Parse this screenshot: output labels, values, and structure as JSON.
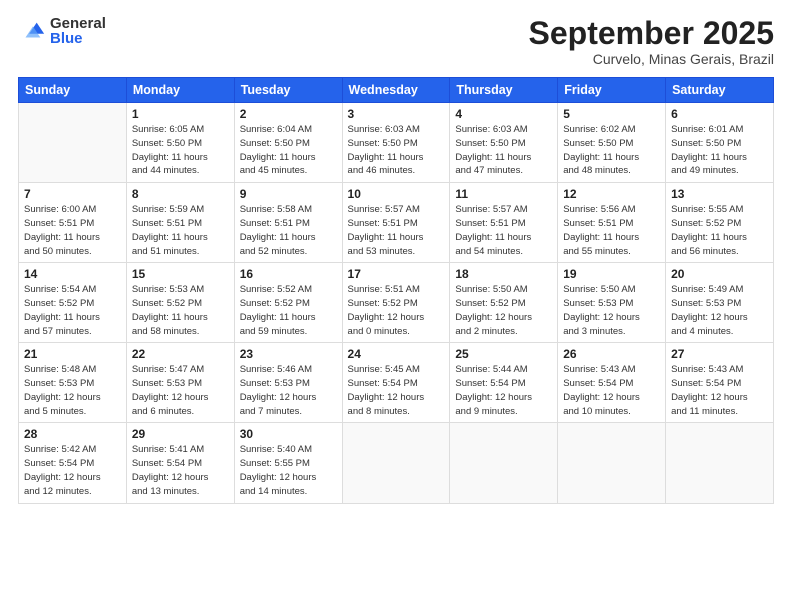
{
  "logo": {
    "general": "General",
    "blue": "Blue"
  },
  "title": "September 2025",
  "location": "Curvelo, Minas Gerais, Brazil",
  "days_of_week": [
    "Sunday",
    "Monday",
    "Tuesday",
    "Wednesday",
    "Thursday",
    "Friday",
    "Saturday"
  ],
  "weeks": [
    [
      {
        "day": "",
        "info": ""
      },
      {
        "day": "1",
        "info": "Sunrise: 6:05 AM\nSunset: 5:50 PM\nDaylight: 11 hours\nand 44 minutes."
      },
      {
        "day": "2",
        "info": "Sunrise: 6:04 AM\nSunset: 5:50 PM\nDaylight: 11 hours\nand 45 minutes."
      },
      {
        "day": "3",
        "info": "Sunrise: 6:03 AM\nSunset: 5:50 PM\nDaylight: 11 hours\nand 46 minutes."
      },
      {
        "day": "4",
        "info": "Sunrise: 6:03 AM\nSunset: 5:50 PM\nDaylight: 11 hours\nand 47 minutes."
      },
      {
        "day": "5",
        "info": "Sunrise: 6:02 AM\nSunset: 5:50 PM\nDaylight: 11 hours\nand 48 minutes."
      },
      {
        "day": "6",
        "info": "Sunrise: 6:01 AM\nSunset: 5:50 PM\nDaylight: 11 hours\nand 49 minutes."
      }
    ],
    [
      {
        "day": "7",
        "info": "Sunrise: 6:00 AM\nSunset: 5:51 PM\nDaylight: 11 hours\nand 50 minutes."
      },
      {
        "day": "8",
        "info": "Sunrise: 5:59 AM\nSunset: 5:51 PM\nDaylight: 11 hours\nand 51 minutes."
      },
      {
        "day": "9",
        "info": "Sunrise: 5:58 AM\nSunset: 5:51 PM\nDaylight: 11 hours\nand 52 minutes."
      },
      {
        "day": "10",
        "info": "Sunrise: 5:57 AM\nSunset: 5:51 PM\nDaylight: 11 hours\nand 53 minutes."
      },
      {
        "day": "11",
        "info": "Sunrise: 5:57 AM\nSunset: 5:51 PM\nDaylight: 11 hours\nand 54 minutes."
      },
      {
        "day": "12",
        "info": "Sunrise: 5:56 AM\nSunset: 5:51 PM\nDaylight: 11 hours\nand 55 minutes."
      },
      {
        "day": "13",
        "info": "Sunrise: 5:55 AM\nSunset: 5:52 PM\nDaylight: 11 hours\nand 56 minutes."
      }
    ],
    [
      {
        "day": "14",
        "info": "Sunrise: 5:54 AM\nSunset: 5:52 PM\nDaylight: 11 hours\nand 57 minutes."
      },
      {
        "day": "15",
        "info": "Sunrise: 5:53 AM\nSunset: 5:52 PM\nDaylight: 11 hours\nand 58 minutes."
      },
      {
        "day": "16",
        "info": "Sunrise: 5:52 AM\nSunset: 5:52 PM\nDaylight: 11 hours\nand 59 minutes."
      },
      {
        "day": "17",
        "info": "Sunrise: 5:51 AM\nSunset: 5:52 PM\nDaylight: 12 hours\nand 0 minutes."
      },
      {
        "day": "18",
        "info": "Sunrise: 5:50 AM\nSunset: 5:52 PM\nDaylight: 12 hours\nand 2 minutes."
      },
      {
        "day": "19",
        "info": "Sunrise: 5:50 AM\nSunset: 5:53 PM\nDaylight: 12 hours\nand 3 minutes."
      },
      {
        "day": "20",
        "info": "Sunrise: 5:49 AM\nSunset: 5:53 PM\nDaylight: 12 hours\nand 4 minutes."
      }
    ],
    [
      {
        "day": "21",
        "info": "Sunrise: 5:48 AM\nSunset: 5:53 PM\nDaylight: 12 hours\nand 5 minutes."
      },
      {
        "day": "22",
        "info": "Sunrise: 5:47 AM\nSunset: 5:53 PM\nDaylight: 12 hours\nand 6 minutes."
      },
      {
        "day": "23",
        "info": "Sunrise: 5:46 AM\nSunset: 5:53 PM\nDaylight: 12 hours\nand 7 minutes."
      },
      {
        "day": "24",
        "info": "Sunrise: 5:45 AM\nSunset: 5:54 PM\nDaylight: 12 hours\nand 8 minutes."
      },
      {
        "day": "25",
        "info": "Sunrise: 5:44 AM\nSunset: 5:54 PM\nDaylight: 12 hours\nand 9 minutes."
      },
      {
        "day": "26",
        "info": "Sunrise: 5:43 AM\nSunset: 5:54 PM\nDaylight: 12 hours\nand 10 minutes."
      },
      {
        "day": "27",
        "info": "Sunrise: 5:43 AM\nSunset: 5:54 PM\nDaylight: 12 hours\nand 11 minutes."
      }
    ],
    [
      {
        "day": "28",
        "info": "Sunrise: 5:42 AM\nSunset: 5:54 PM\nDaylight: 12 hours\nand 12 minutes."
      },
      {
        "day": "29",
        "info": "Sunrise: 5:41 AM\nSunset: 5:54 PM\nDaylight: 12 hours\nand 13 minutes."
      },
      {
        "day": "30",
        "info": "Sunrise: 5:40 AM\nSunset: 5:55 PM\nDaylight: 12 hours\nand 14 minutes."
      },
      {
        "day": "",
        "info": ""
      },
      {
        "day": "",
        "info": ""
      },
      {
        "day": "",
        "info": ""
      },
      {
        "day": "",
        "info": ""
      }
    ]
  ]
}
